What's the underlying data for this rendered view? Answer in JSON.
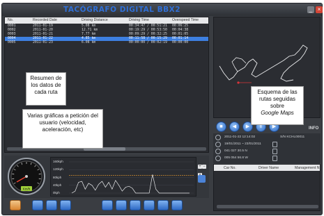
{
  "app": {
    "title": "TACÓGRAFO DIGITAL BBX2"
  },
  "route_table": {
    "columns": [
      "No.",
      "Recorded Date",
      "Driving Distance",
      "Driving Time",
      "Overspeed Time"
    ],
    "rows": [
      [
        "0001",
        "2011-01-19",
        "5.08 km",
        "00:34:47 / 00:51:21",
        "00:06:25"
      ],
      [
        "0002",
        "2011-01-20",
        "12.71 km",
        "00:19:29 / 00:53:50",
        "00:04:38"
      ],
      [
        "0003",
        "2011-01-21",
        "7.77 km",
        "00:09:29 / 00:32:25",
        "00:01:05"
      ],
      [
        "0004",
        "2011-01-22",
        "4.85 km",
        "00:11:58 / 00:15:29",
        "00:01:14"
      ],
      [
        "0005",
        "2011-01-23",
        "6.08 km",
        "00:00:00 / 00:02:19",
        "00:00:00"
      ]
    ],
    "selected_index": 3
  },
  "callouts": {
    "routes_summary": "Resumen de los datos de cada ruta",
    "graphs": "Varias gráficas a petición del usuario (velocidad, aceleración, etc)",
    "map_line1": "Esquema de las rutas seguidas sobre",
    "map_line2": "Google Maps"
  },
  "playback": {
    "info_label": "INFO"
  },
  "info": {
    "row1_a": "2011-01-22  12:14:02",
    "row1_b": "S/N   KCHL00011",
    "row2_a": "19/01/2011 ~ 23/01/2011",
    "row2_b": "",
    "row3_a": "041 027 30.5 N",
    "row3_b": "",
    "row4_a": "005 054 56.8 W",
    "row4_b": ""
  },
  "driver_table": {
    "columns": [
      "Car No.",
      "Driver Name",
      "Management N"
    ]
  },
  "graph": {
    "y_ticks": [
      "160kph",
      "120kph",
      "80kph",
      "40kph",
      "0kph"
    ],
    "zoom_value": "x 1",
    "gauge_badge": "Km/h"
  },
  "chart_data": {
    "type": "line",
    "ylabel": "",
    "ylim": [
      0,
      160
    ],
    "y_ticks": [
      0,
      40,
      80,
      120,
      160
    ],
    "limit_line": 90,
    "series": [
      {
        "values": [
          0,
          10,
          55,
          60,
          20,
          50,
          40,
          15,
          45,
          60,
          30,
          55,
          20,
          65,
          40,
          10,
          30,
          35,
          25,
          0,
          0,
          0,
          0,
          0,
          95,
          20,
          0,
          0,
          0,
          0,
          0,
          0,
          0,
          0,
          0,
          0
        ]
      }
    ]
  },
  "colors": {
    "selected_row": "#3d7fe0",
    "title": "#2f6fd6",
    "route_line": "#ffffff",
    "limit_line": "#f0a030"
  }
}
